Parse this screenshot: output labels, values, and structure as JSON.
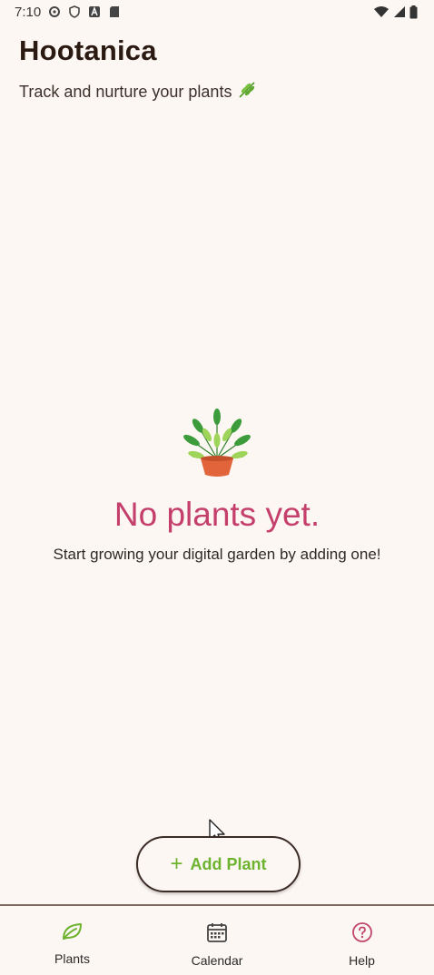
{
  "status_bar": {
    "time": "7:10",
    "icons_left": [
      "settings-icon",
      "shield-icon",
      "a-badge-icon",
      "sd-card-icon"
    ],
    "icons_right": [
      "wifi-icon",
      "signal-icon",
      "battery-icon"
    ]
  },
  "header": {
    "title": "Hootanica",
    "subtitle": "Track and nurture your plants",
    "subtitle_emoji": "🌿"
  },
  "empty_state": {
    "title": "No plants yet.",
    "description": "Start growing your digital garden by adding one!"
  },
  "actions": {
    "add_plant_label": "Add Plant"
  },
  "bottom_nav": {
    "items": [
      {
        "label": "Plants",
        "icon": "leaf-icon",
        "active": true
      },
      {
        "label": "Calendar",
        "icon": "calendar-icon",
        "active": false
      },
      {
        "label": "Help",
        "icon": "help-icon",
        "active": false
      }
    ]
  },
  "colors": {
    "background": "#fdf7f3",
    "accent_green": "#6db32f",
    "empty_title_pink": "#c43f6c",
    "help_pink": "#c2456f"
  }
}
